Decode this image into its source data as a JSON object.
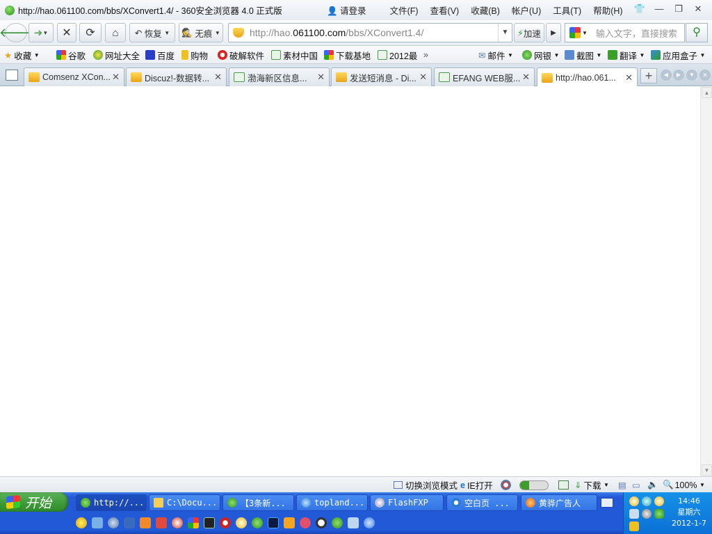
{
  "window": {
    "title": "http://hao.061100.com/bbs/XConvert1.4/ - 360安全浏览器 4.0 正式版",
    "login": "请登录",
    "menu": [
      "文件(F)",
      "查看(V)",
      "收藏(B)",
      "帐户(U)",
      "工具(T)",
      "帮助(H)"
    ]
  },
  "toolbar": {
    "restore_label": "恢复",
    "private_label": "无痕",
    "url_prefix": "http://hao.",
    "url_domain": "061100.com",
    "url_path": "/bbs/XConvert1.4/",
    "accelerate_label": "加速",
    "search_placeholder": "输入文字，直接搜索"
  },
  "bookmarks": {
    "favorites_label": "收藏",
    "items": [
      "谷歌",
      "网址大全",
      "百度",
      "购物",
      "破解软件",
      "素材中国",
      "下载基地",
      "2012最"
    ],
    "right_items": [
      "邮件",
      "网银",
      "截图",
      "翻译",
      "应用盒子"
    ]
  },
  "tabs": [
    {
      "label": "Comsenz XCon..."
    },
    {
      "label": "Discuz!-数据转..."
    },
    {
      "label": "渤海新区信息..."
    },
    {
      "label": "发送短消息 - Di..."
    },
    {
      "label": "EFANG WEB服..."
    },
    {
      "label": "http://hao.061..."
    }
  ],
  "status": {
    "switch_mode": "切换浏览模式",
    "ie_open": "IE打开",
    "download": "下载",
    "zoom": "100%"
  },
  "taskbar": {
    "start_label": "开始",
    "items": [
      "http://...",
      "C:\\Docu...",
      "【3条新...",
      "topland...",
      "FlashFXP",
      "空白页 ...",
      "黄骅广告人"
    ],
    "time": "14:46",
    "weekday": "星期六",
    "date": "2012-1-7"
  },
  "colors": {
    "taskbar_blue": "#2259d7",
    "start_green": "#3b9a36",
    "tray_blue": "#0c70d6"
  }
}
